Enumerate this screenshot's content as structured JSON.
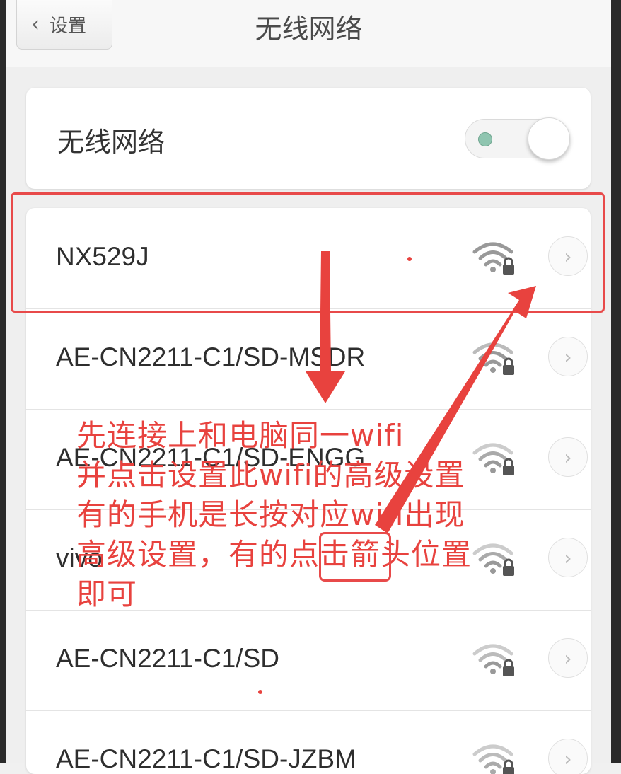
{
  "navbar": {
    "back_label": "设置",
    "title": "无线网络"
  },
  "wifi_toggle": {
    "label": "无线网络",
    "state": "on"
  },
  "networks": [
    {
      "ssid": "NX529J",
      "icon": "wifi-lock-icon"
    },
    {
      "ssid": "AE-CN2211-C1/SD-MSDR",
      "icon": "wifi-lock-icon"
    },
    {
      "ssid": "AE-CN2211-C1/SD-ENGG",
      "icon": "wifi-lock-icon"
    },
    {
      "ssid": "vivo",
      "icon": "wifi-lock-icon"
    },
    {
      "ssid": "AE-CN2211-C1/SD",
      "icon": "wifi-lock-icon"
    },
    {
      "ssid": "AE-CN2211-C1/SD-JZBM",
      "icon": "wifi-lock-icon"
    }
  ],
  "annotation": {
    "lines": [
      "先连接上和电脑同一wifi",
      "并点击设置此wifi的高级设置",
      "有的手机是长按对应wifi出现",
      "高级设置，有的点击箭头位置",
      "即可"
    ],
    "color": "#e8423e"
  }
}
